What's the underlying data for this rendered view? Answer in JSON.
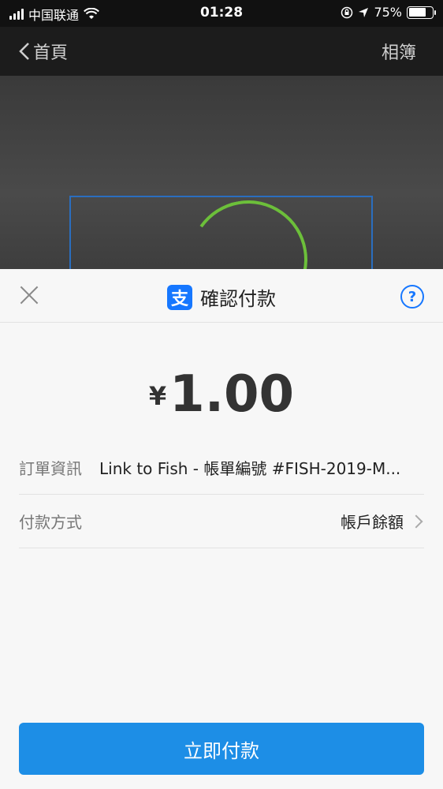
{
  "status_bar": {
    "carrier": "中国联通",
    "time": "01:28",
    "battery": "75%",
    "battery_level": 0.75
  },
  "nav": {
    "back_label": "首頁",
    "right_label": "相簿"
  },
  "sheet": {
    "title": "確認付款",
    "logo_glyph": "支",
    "help_glyph": "?",
    "amount_currency": "¥",
    "amount_value": "1.00",
    "order_label": "訂單資訊",
    "order_value": "Link to Fish - 帳單編號 #FISH-2019-M...",
    "method_label": "付款方式",
    "method_value": "帳戶餘額",
    "pay_button": "立即付款"
  },
  "colors": {
    "accent": "#1d8ee6",
    "alipay_blue": "#1677ff"
  },
  "icons": [
    "signal-icon",
    "wifi-icon",
    "lock-rotation-icon",
    "location-icon",
    "battery-icon",
    "back-chevron-icon",
    "close-icon",
    "alipay-logo-icon",
    "help-icon",
    "chevron-right-icon"
  ]
}
